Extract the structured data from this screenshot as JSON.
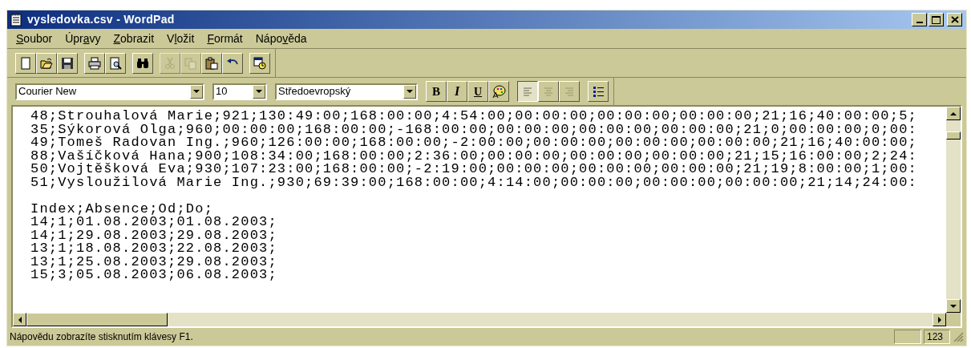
{
  "window": {
    "title": "vysledovka.csv - WordPad"
  },
  "menu": [
    {
      "key": "S",
      "after": "oubor"
    },
    {
      "before": "Úpr",
      "key": "a",
      "after": "vy"
    },
    {
      "key": "Z",
      "after": "obrazit"
    },
    {
      "before": "V",
      "key": "l",
      "after": "ožit"
    },
    {
      "key": "F",
      "after": "ormát"
    },
    {
      "before": "Nápo",
      "key": "v",
      "after": "ěda"
    }
  ],
  "toolbar": [
    [
      {
        "disabled": false
      },
      {
        "disabled": false
      },
      {
        "disabled": false
      }
    ],
    [
      {
        "disabled": false
      },
      {
        "disabled": false
      }
    ],
    [
      {
        "disabled": false
      }
    ],
    [
      {
        "disabled": true
      },
      {
        "disabled": true
      },
      {
        "disabled": false
      },
      {
        "disabled": false
      }
    ],
    [
      {
        "disabled": false
      }
    ]
  ],
  "format_bar": {
    "font": "Courier New",
    "size": "10",
    "script": "Středoevropský",
    "styles": [
      "B",
      "I",
      "U"
    ],
    "align": [
      {
        "selected": true
      },
      {
        "selected": false
      },
      {
        "selected": false
      }
    ]
  },
  "document": {
    "blocks": [
      [
        "48;Strouhalová Marie;921;130:49:00;168:00:00;4:54:00;00:00:00;00:00:00;00:00:00;21;16;40:00:00;5;",
        "35;Sýkorová Olga;960;00:00:00;168:00:00;-168:00:00;00:00:00;00:00:00;00:00:00;21;0;00:00:00;0;00:",
        "49;Tomeš Radovan Ing.;960;126:00:00;168:00:00;-2:00:00;00:00:00;00:00:00;00:00:00;21;16;40:00:00;",
        "88;Vašíčková Hana;900;108:34:00;168:00:00;2:36:00;00:00:00;00:00:00;00:00:00;21;15;16:00:00;2;24:",
        "50;Vojtěšková Eva;930;107:23:00;168:00:00;-2:19:00;00:00:00;00:00:00;00:00:00;21;19;8:00:00;1;00:",
        "51;Vysloužilová Marie Ing.;930;69:39:00;168:00:00;4:14:00;00:00:00;00:00:00;00:00:00;21;14;24:00:"
      ],
      [
        "Index;Absence;Od;Do;",
        "14;1;01.08.2003;01.08.2003;",
        "14;1;29.08.2003;29.08.2003;",
        "13;1;18.08.2003;22.08.2003;",
        "13;1;25.08.2003;29.08.2003;",
        "15;3;05.08.2003;06.08.2003;"
      ]
    ]
  },
  "status_bar": {
    "text": "Nápovědu zobrazíte stisknutím klávesy F1.",
    "panel_text": "123"
  }
}
